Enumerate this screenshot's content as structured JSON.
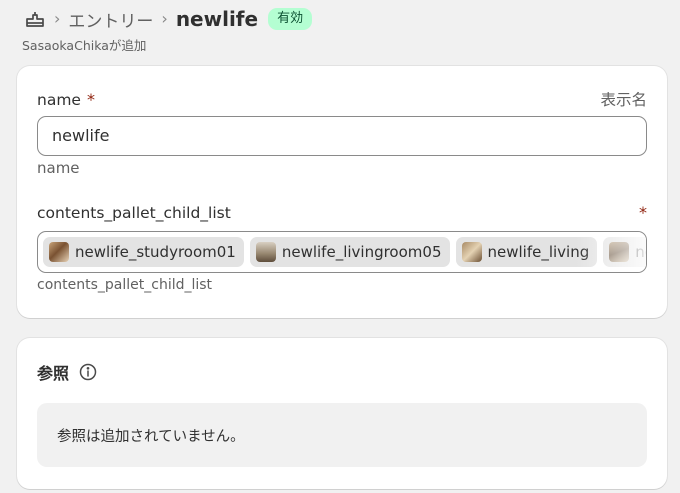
{
  "breadcrumb": {
    "parent_label": "エントリー",
    "title": "newlife",
    "status_badge": "有効",
    "subtitle": "SasaokaChikaが追加"
  },
  "fields": {
    "name": {
      "label": "name",
      "required_mark": "*",
      "side_label": "表示名",
      "value": "newlife",
      "help": "name"
    },
    "contents_list": {
      "label": "contents_pallet_child_list",
      "required_mark": "*",
      "items": [
        {
          "label": "newlife_studyroom01"
        },
        {
          "label": "newlife_livingroom05"
        },
        {
          "label": "newlife_living"
        },
        {
          "label": "newlif"
        }
      ],
      "help": "contents_pallet_child_list"
    }
  },
  "references": {
    "title": "参照",
    "empty_message": "参照は追加されていません。"
  }
}
